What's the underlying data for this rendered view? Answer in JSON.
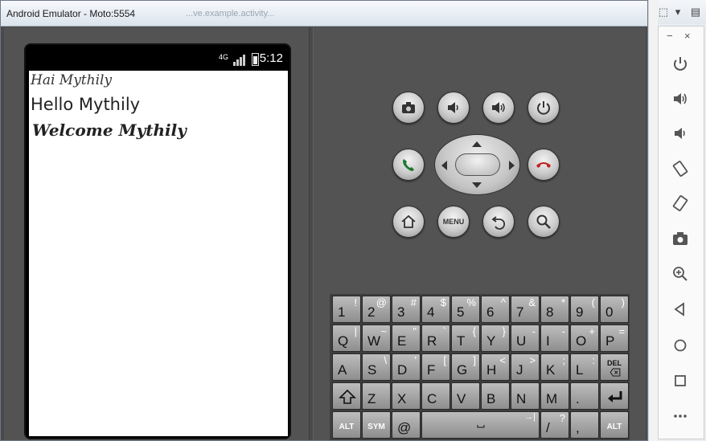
{
  "window": {
    "title": "Android Emulator - Moto:5554",
    "ghost_title": "...ve.example.activity..."
  },
  "ide": {
    "buttons": [
      "⬚",
      "▾",
      "▤"
    ]
  },
  "status_bar": {
    "clock": "5:12",
    "network": "4G"
  },
  "app": {
    "line1": "Hai Mythily",
    "line2": "Hello Mythily",
    "line3": "Welcome Mythily"
  },
  "hardware": {
    "buttons": [
      "camera-icon",
      "volume-down-icon",
      "volume-up-icon",
      "power-icon",
      "call-icon",
      "end-call-icon",
      "home-icon",
      "menu-button",
      "back-icon",
      "search-icon"
    ],
    "menu_label": "MENU"
  },
  "keyboard": {
    "row1": [
      [
        "1",
        "!"
      ],
      [
        "2",
        "@"
      ],
      [
        "3",
        "#"
      ],
      [
        "4",
        "$"
      ],
      [
        "5",
        "%"
      ],
      [
        "6",
        "^"
      ],
      [
        "7",
        "&"
      ],
      [
        "8",
        "*"
      ],
      [
        "9",
        "("
      ],
      [
        "0",
        ")"
      ]
    ],
    "row2": [
      [
        "Q",
        "|"
      ],
      [
        "W",
        "~"
      ],
      [
        "E",
        "\""
      ],
      [
        "R",
        "`"
      ],
      [
        "T",
        "{"
      ],
      [
        "Y",
        "}"
      ],
      [
        "U",
        "-"
      ],
      [
        "I",
        "-"
      ],
      [
        "O",
        "+"
      ],
      [
        "P",
        "="
      ]
    ],
    "row3": [
      [
        "A",
        ""
      ],
      [
        "S",
        "\\"
      ],
      [
        "D",
        "'"
      ],
      [
        "F",
        "["
      ],
      [
        "G",
        "]"
      ],
      [
        "H",
        "<"
      ],
      [
        "J",
        ">"
      ],
      [
        "K",
        ";"
      ],
      [
        "L",
        ":"
      ],
      [
        "DEL",
        ""
      ]
    ],
    "row4": [
      [
        "⇧",
        ""
      ],
      [
        "Z",
        ""
      ],
      [
        "X",
        ""
      ],
      [
        "C",
        ""
      ],
      [
        "V",
        ""
      ],
      [
        "B",
        ""
      ],
      [
        "N",
        ""
      ],
      [
        "M",
        ""
      ],
      [
        ".",
        ""
      ],
      [
        "↵",
        ""
      ]
    ],
    "row5": [
      [
        "ALT",
        ""
      ],
      [
        "SYM",
        ""
      ],
      [
        "@",
        ""
      ],
      [
        "␣",
        ""
      ],
      [
        "/",
        "?"
      ],
      [
        ",",
        ""
      ],
      [
        "ALT",
        ""
      ]
    ]
  },
  "side_toolbar": {
    "minimize": "−",
    "close": "×",
    "items": [
      "power-icon",
      "volume-up-icon",
      "volume-down-icon",
      "rotate-left-icon",
      "rotate-right-icon",
      "camera-icon",
      "zoom-icon",
      "back-icon",
      "home-icon",
      "overview-icon",
      "more-icon"
    ]
  }
}
